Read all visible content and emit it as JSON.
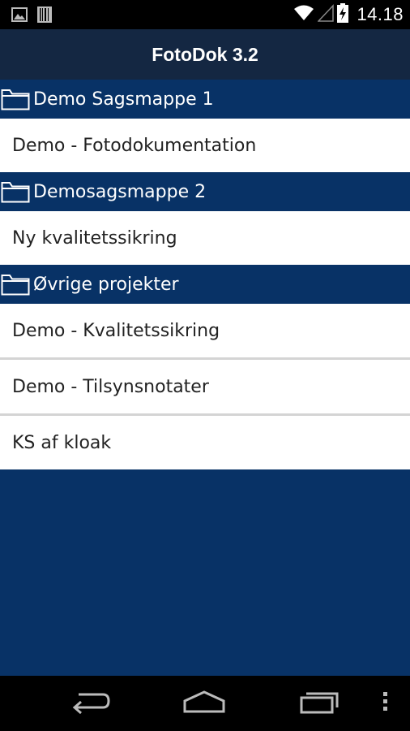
{
  "status_bar": {
    "time": "14.18",
    "icons_left": [
      "picture-icon",
      "barcode-icon"
    ],
    "icons_right": [
      "wifi-icon",
      "cell-signal-icon",
      "battery-charging-icon"
    ]
  },
  "app": {
    "title": "FotoDok 3.2"
  },
  "sections": [
    {
      "header": "Demo Sagsmappe 1",
      "items": [
        "Demo - Fotodokumentation"
      ]
    },
    {
      "header": "Demosagsmappe 2",
      "items": [
        "Ny kvalitetssikring"
      ]
    },
    {
      "header": "Øvrige projekter",
      "items": [
        "Demo - Kvalitetssikring",
        "Demo - Tilsynsnotater",
        "KS af kloak"
      ]
    }
  ],
  "colors": {
    "header_blue": "#083266",
    "action_bar": "#142742",
    "item_bg": "#ffffff",
    "item_text": "#222222"
  },
  "nav_bar": {
    "buttons": [
      "back-icon",
      "home-icon",
      "recent-apps-icon",
      "overflow-menu-icon"
    ]
  }
}
